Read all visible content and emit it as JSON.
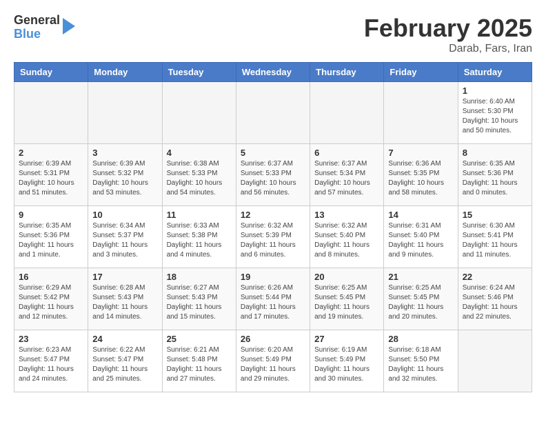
{
  "logo": {
    "general": "General",
    "blue": "Blue"
  },
  "title": "February 2025",
  "subtitle": "Darab, Fars, Iran",
  "days_of_week": [
    "Sunday",
    "Monday",
    "Tuesday",
    "Wednesday",
    "Thursday",
    "Friday",
    "Saturday"
  ],
  "weeks": [
    [
      {
        "num": "",
        "info": ""
      },
      {
        "num": "",
        "info": ""
      },
      {
        "num": "",
        "info": ""
      },
      {
        "num": "",
        "info": ""
      },
      {
        "num": "",
        "info": ""
      },
      {
        "num": "",
        "info": ""
      },
      {
        "num": "1",
        "info": "Sunrise: 6:40 AM\nSunset: 5:30 PM\nDaylight: 10 hours\nand 50 minutes."
      }
    ],
    [
      {
        "num": "2",
        "info": "Sunrise: 6:39 AM\nSunset: 5:31 PM\nDaylight: 10 hours\nand 51 minutes."
      },
      {
        "num": "3",
        "info": "Sunrise: 6:39 AM\nSunset: 5:32 PM\nDaylight: 10 hours\nand 53 minutes."
      },
      {
        "num": "4",
        "info": "Sunrise: 6:38 AM\nSunset: 5:33 PM\nDaylight: 10 hours\nand 54 minutes."
      },
      {
        "num": "5",
        "info": "Sunrise: 6:37 AM\nSunset: 5:33 PM\nDaylight: 10 hours\nand 56 minutes."
      },
      {
        "num": "6",
        "info": "Sunrise: 6:37 AM\nSunset: 5:34 PM\nDaylight: 10 hours\nand 57 minutes."
      },
      {
        "num": "7",
        "info": "Sunrise: 6:36 AM\nSunset: 5:35 PM\nDaylight: 10 hours\nand 58 minutes."
      },
      {
        "num": "8",
        "info": "Sunrise: 6:35 AM\nSunset: 5:36 PM\nDaylight: 11 hours\nand 0 minutes."
      }
    ],
    [
      {
        "num": "9",
        "info": "Sunrise: 6:35 AM\nSunset: 5:36 PM\nDaylight: 11 hours\nand 1 minute."
      },
      {
        "num": "10",
        "info": "Sunrise: 6:34 AM\nSunset: 5:37 PM\nDaylight: 11 hours\nand 3 minutes."
      },
      {
        "num": "11",
        "info": "Sunrise: 6:33 AM\nSunset: 5:38 PM\nDaylight: 11 hours\nand 4 minutes."
      },
      {
        "num": "12",
        "info": "Sunrise: 6:32 AM\nSunset: 5:39 PM\nDaylight: 11 hours\nand 6 minutes."
      },
      {
        "num": "13",
        "info": "Sunrise: 6:32 AM\nSunset: 5:40 PM\nDaylight: 11 hours\nand 8 minutes."
      },
      {
        "num": "14",
        "info": "Sunrise: 6:31 AM\nSunset: 5:40 PM\nDaylight: 11 hours\nand 9 minutes."
      },
      {
        "num": "15",
        "info": "Sunrise: 6:30 AM\nSunset: 5:41 PM\nDaylight: 11 hours\nand 11 minutes."
      }
    ],
    [
      {
        "num": "16",
        "info": "Sunrise: 6:29 AM\nSunset: 5:42 PM\nDaylight: 11 hours\nand 12 minutes."
      },
      {
        "num": "17",
        "info": "Sunrise: 6:28 AM\nSunset: 5:43 PM\nDaylight: 11 hours\nand 14 minutes."
      },
      {
        "num": "18",
        "info": "Sunrise: 6:27 AM\nSunset: 5:43 PM\nDaylight: 11 hours\nand 15 minutes."
      },
      {
        "num": "19",
        "info": "Sunrise: 6:26 AM\nSunset: 5:44 PM\nDaylight: 11 hours\nand 17 minutes."
      },
      {
        "num": "20",
        "info": "Sunrise: 6:25 AM\nSunset: 5:45 PM\nDaylight: 11 hours\nand 19 minutes."
      },
      {
        "num": "21",
        "info": "Sunrise: 6:25 AM\nSunset: 5:45 PM\nDaylight: 11 hours\nand 20 minutes."
      },
      {
        "num": "22",
        "info": "Sunrise: 6:24 AM\nSunset: 5:46 PM\nDaylight: 11 hours\nand 22 minutes."
      }
    ],
    [
      {
        "num": "23",
        "info": "Sunrise: 6:23 AM\nSunset: 5:47 PM\nDaylight: 11 hours\nand 24 minutes."
      },
      {
        "num": "24",
        "info": "Sunrise: 6:22 AM\nSunset: 5:47 PM\nDaylight: 11 hours\nand 25 minutes."
      },
      {
        "num": "25",
        "info": "Sunrise: 6:21 AM\nSunset: 5:48 PM\nDaylight: 11 hours\nand 27 minutes."
      },
      {
        "num": "26",
        "info": "Sunrise: 6:20 AM\nSunset: 5:49 PM\nDaylight: 11 hours\nand 29 minutes."
      },
      {
        "num": "27",
        "info": "Sunrise: 6:19 AM\nSunset: 5:49 PM\nDaylight: 11 hours\nand 30 minutes."
      },
      {
        "num": "28",
        "info": "Sunrise: 6:18 AM\nSunset: 5:50 PM\nDaylight: 11 hours\nand 32 minutes."
      },
      {
        "num": "",
        "info": ""
      }
    ]
  ]
}
